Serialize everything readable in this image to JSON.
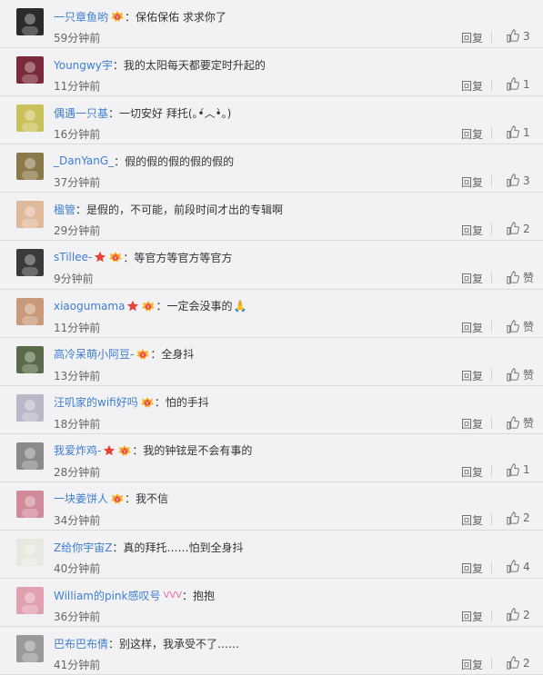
{
  "ui": {
    "reply_label": "回复",
    "colon": "：",
    "accent_color": "#3f7ed0"
  },
  "comments": [
    {
      "user": "一只章鱼哟",
      "badge": true,
      "star": false,
      "text": "保佑保佑 求求你了",
      "emoji": "",
      "time": "59分钟前",
      "likes": "3",
      "avatar": "#2b2b2b"
    },
    {
      "user": "Youngwy宇",
      "badge": false,
      "star": false,
      "text": "我的太阳每天都要定时升起的",
      "emoji": "",
      "time": "11分钟前",
      "likes": "1",
      "avatar": "#7a2a3a"
    },
    {
      "user": "偶遇一只基",
      "badge": false,
      "star": false,
      "text": "一切安好 拜托(｡•́︿•̀｡)",
      "emoji": "",
      "time": "16分钟前",
      "likes": "1",
      "avatar": "#c9c25a"
    },
    {
      "user": "_DanYanG_",
      "badge": false,
      "star": false,
      "text": "假的假的假的假的假的",
      "emoji": "",
      "time": "37分钟前",
      "likes": "3",
      "avatar": "#8a7a4a"
    },
    {
      "user": "楹管",
      "badge": false,
      "star": false,
      "text": "是假的，不可能，前段时间才出的专辑啊",
      "emoji": "",
      "time": "29分钟前",
      "likes": "2",
      "avatar": "#e0b89a"
    },
    {
      "user": "sTillee-",
      "badge": true,
      "star": true,
      "text": "等官方等官方等官方",
      "emoji": "",
      "time": "9分钟前",
      "likes": "赞",
      "avatar": "#3a3a3a"
    },
    {
      "user": "xiaogumama",
      "badge": true,
      "star": true,
      "text": "一定会没事的",
      "emoji": "🙏",
      "time": "11分钟前",
      "likes": "赞",
      "avatar": "#c99a7a"
    },
    {
      "user": "高冷呆萌小阿豆-",
      "badge": true,
      "star": false,
      "text": "全身抖",
      "emoji": "",
      "time": "13分钟前",
      "likes": "赞",
      "avatar": "#5a6a4a"
    },
    {
      "user": "汪叽家的wifi好吗",
      "badge": true,
      "star": false,
      "text": "怕的手抖",
      "emoji": "",
      "time": "18分钟前",
      "likes": "赞",
      "avatar": "#b8b8c8"
    },
    {
      "user": "我爱炸鸡-",
      "badge": true,
      "star": true,
      "text": "我的钟铉是不会有事的",
      "emoji": "",
      "time": "28分钟前",
      "likes": "1",
      "avatar": "#8a8a8a"
    },
    {
      "user": "一块姜饼人",
      "badge": true,
      "star": false,
      "text": "我不信",
      "emoji": "",
      "time": "34分钟前",
      "likes": "2",
      "avatar": "#d08a9a"
    },
    {
      "user": "Z给你宇宙Z",
      "badge": false,
      "star": false,
      "text": "真的拜托……怕到全身抖",
      "emoji": "",
      "time": "40分钟前",
      "likes": "4",
      "avatar": "#e8e8e0"
    },
    {
      "user": "William的pink感叹号",
      "badge": false,
      "star": false,
      "vip": "VVV",
      "text": "抱抱",
      "emoji": "",
      "time": "36分钟前",
      "likes": "2",
      "avatar": "#e0a0b0"
    },
    {
      "user": "巴布巴布倩",
      "badge": false,
      "star": false,
      "text": "别这样，我承受不了……",
      "emoji": "",
      "time": "41分钟前",
      "likes": "2",
      "avatar": "#9a9a9a"
    }
  ]
}
